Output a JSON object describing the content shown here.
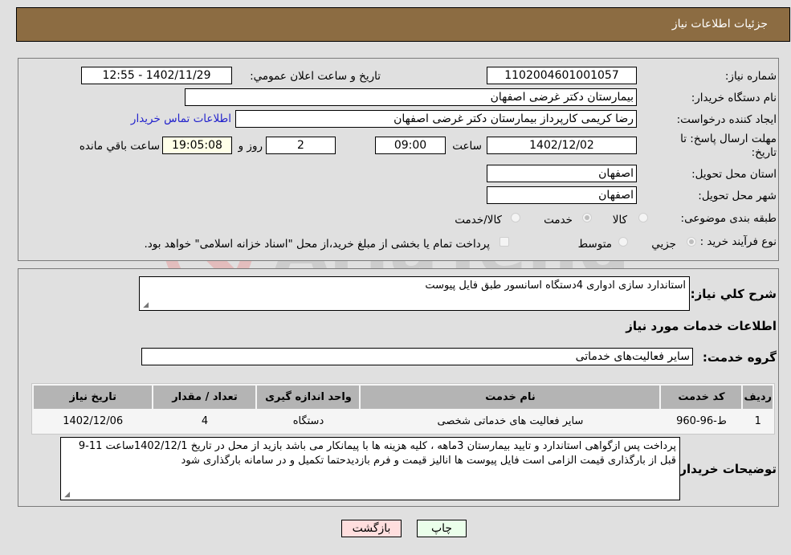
{
  "header": {
    "title": "جزئیات اطلاعات نیاز"
  },
  "form": {
    "need_number": {
      "label": "شماره نیاز:",
      "value": "1102004601001057"
    },
    "announce_datetime": {
      "label": "تاریخ و ساعت اعلان عمومي:",
      "value": "1402/11/29 - 12:55"
    },
    "buyer_org": {
      "label": "نام دستگاه خريدار:",
      "value": "بیمارستان دکتر غرضی اصفهان"
    },
    "requester": {
      "label": "ايجاد کننده درخواست:",
      "value": "رضا کریمی کارپرداز بیمارستان دکتر غرضی اصفهان",
      "contact_link": "اطلاعات تماس خريدار"
    },
    "deadline": {
      "label": "مهلت ارسال پاسخ: تا تاریخ:",
      "date": "1402/12/02",
      "time_label": "ساعت",
      "time": "09:00",
      "days": "2",
      "days_label": "روز و",
      "remaining": "19:05:08",
      "remaining_label": "ساعت باقي مانده"
    },
    "province": {
      "label": "استان محل تحویل:",
      "value": "اصفهان"
    },
    "city": {
      "label": "شهر محل تحویل:",
      "value": "اصفهان"
    },
    "category": {
      "label": "طبقه بندی موضوعی:",
      "options": [
        "کالا",
        "خدمت",
        "کالا/خدمت"
      ],
      "selected": "خدمت"
    },
    "purchase_type": {
      "label": "نوع فرآیند خرید :",
      "options": [
        "جزيي",
        "متوسط"
      ],
      "selected": "جزيي",
      "treasury_note": "پرداخت تمام یا بخشی از مبلغ خرید،از محل \"اسناد خزانه اسلامی\" خواهد بود."
    }
  },
  "details": {
    "description_label": "شرح كلي نياز:",
    "description": "استاندارد سازی ادواری  4دستگاه اسانسور طبق فایل پیوست",
    "services_heading": "اطلاعات خدمات مورد نياز",
    "service_group_label": "گروه خدمت:",
    "service_group": "سایر فعالیت‌های خدماتی",
    "table": {
      "headers": [
        "رديف",
        "کد خدمت",
        "نام خدمت",
        "واحد اندازه گيری",
        "تعداد / مقدار",
        "تاريخ نياز"
      ],
      "rows": [
        [
          "1",
          "ط-96-960",
          "سایر فعالیت های خدماتی شخصی",
          "دستگاه",
          "4",
          "1402/12/06"
        ]
      ]
    },
    "buyer_notes_label": "توضيحات خريدار:",
    "buyer_notes": "پرداخت پس ازگواهی استاندارد و تایید  بیمارستان 3ماهه ، کلیه هزینه ها با پیمانکار می باشد بازید از محل در تاریخ 1402/12/1ساعت 11-9 قبل از بارگذاری قیمت الزامی است فایل پیوست ها  انالیز قیمت و فرم بازدیدحتما تکمیل و در سامانه بارگذاری شود"
  },
  "buttons": {
    "print": "چاپ",
    "back": "بازگشت"
  },
  "colors": {
    "header_bg": "#8c6c42",
    "print_bg": "#eaffea",
    "back_bg": "#ffdede",
    "link": "#2222cc"
  }
}
